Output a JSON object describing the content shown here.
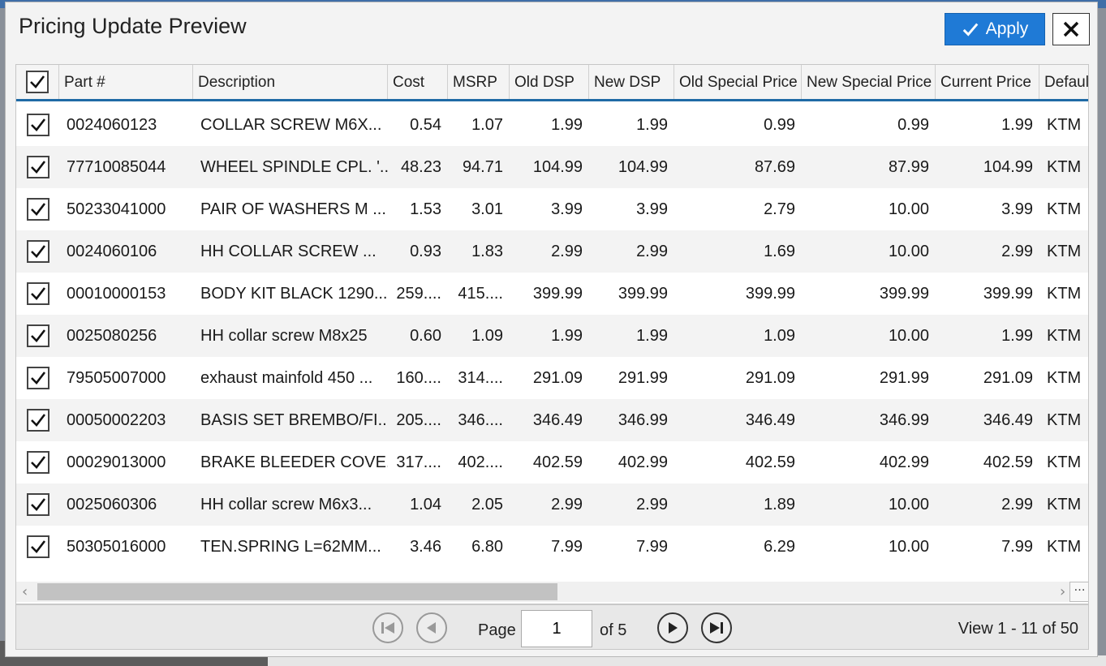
{
  "dialog": {
    "title": "Pricing Update Preview",
    "apply_label": "Apply"
  },
  "columns": [
    "Part #",
    "Description",
    "Cost",
    "MSRP",
    "Old DSP",
    "New DSP",
    "Old Special Price",
    "New Special Price",
    "Current Price",
    "Defaul"
  ],
  "rows": [
    {
      "part": "0024060123",
      "desc": "COLLAR SCREW M6X...",
      "cost": "0.54",
      "msrp": "1.07",
      "old_dsp": "1.99",
      "new_dsp": "1.99",
      "old_sp": "0.99",
      "new_sp": "0.99",
      "cur": "1.99",
      "def": "KTM"
    },
    {
      "part": "77710085044",
      "desc": "WHEEL SPINDLE CPL. '...",
      "cost": "48.23",
      "msrp": "94.71",
      "old_dsp": "104.99",
      "new_dsp": "104.99",
      "old_sp": "87.69",
      "new_sp": "87.99",
      "cur": "104.99",
      "def": "KTM"
    },
    {
      "part": "50233041000",
      "desc": "PAIR OF WASHERS M ...",
      "cost": "1.53",
      "msrp": "3.01",
      "old_dsp": "3.99",
      "new_dsp": "3.99",
      "old_sp": "2.79",
      "new_sp": "10.00",
      "cur": "3.99",
      "def": "KTM"
    },
    {
      "part": "0024060106",
      "desc": "HH COLLAR SCREW ...",
      "cost": "0.93",
      "msrp": "1.83",
      "old_dsp": "2.99",
      "new_dsp": "2.99",
      "old_sp": "1.69",
      "new_sp": "10.00",
      "cur": "2.99",
      "def": "KTM"
    },
    {
      "part": "00010000153",
      "desc": "BODY KIT BLACK 1290...",
      "cost": "259....",
      "msrp": "415....",
      "old_dsp": "399.99",
      "new_dsp": "399.99",
      "old_sp": "399.99",
      "new_sp": "399.99",
      "cur": "399.99",
      "def": "KTM"
    },
    {
      "part": "0025080256",
      "desc": "HH collar screw M8x25",
      "cost": "0.60",
      "msrp": "1.09",
      "old_dsp": "1.99",
      "new_dsp": "1.99",
      "old_sp": "1.09",
      "new_sp": "10.00",
      "cur": "1.99",
      "def": "KTM"
    },
    {
      "part": "79505007000",
      "desc": "exhaust mainfold 450 ...",
      "cost": "160....",
      "msrp": "314....",
      "old_dsp": "291.09",
      "new_dsp": "291.99",
      "old_sp": "291.09",
      "new_sp": "291.99",
      "cur": "291.09",
      "def": "KTM"
    },
    {
      "part": "00050002203",
      "desc": "BASIS SET BREMBO/FI...",
      "cost": "205....",
      "msrp": "346....",
      "old_dsp": "346.49",
      "new_dsp": "346.99",
      "old_sp": "346.49",
      "new_sp": "346.99",
      "cur": "346.49",
      "def": "KTM"
    },
    {
      "part": "00029013000",
      "desc": "BRAKE BLEEDER COVE...",
      "cost": "317....",
      "msrp": "402....",
      "old_dsp": "402.59",
      "new_dsp": "402.99",
      "old_sp": "402.59",
      "new_sp": "402.99",
      "cur": "402.59",
      "def": "KTM"
    },
    {
      "part": "0025060306",
      "desc": "HH collar screw M6x3...",
      "cost": "1.04",
      "msrp": "2.05",
      "old_dsp": "2.99",
      "new_dsp": "2.99",
      "old_sp": "1.89",
      "new_sp": "10.00",
      "cur": "2.99",
      "def": "KTM"
    },
    {
      "part": "50305016000",
      "desc": "TEN.SPRING L=62MM...",
      "cost": "3.46",
      "msrp": "6.80",
      "old_dsp": "7.99",
      "new_dsp": "7.99",
      "old_sp": "6.29",
      "new_sp": "10.00",
      "cur": "7.99",
      "def": "KTM"
    }
  ],
  "pager": {
    "page_label": "Page",
    "page_value": "1",
    "of_label": "of 5",
    "view_label": "View 1 - 11 of 50"
  },
  "colors": {
    "accent": "#1f7ad6",
    "header_underline": "#1f6aa5"
  }
}
